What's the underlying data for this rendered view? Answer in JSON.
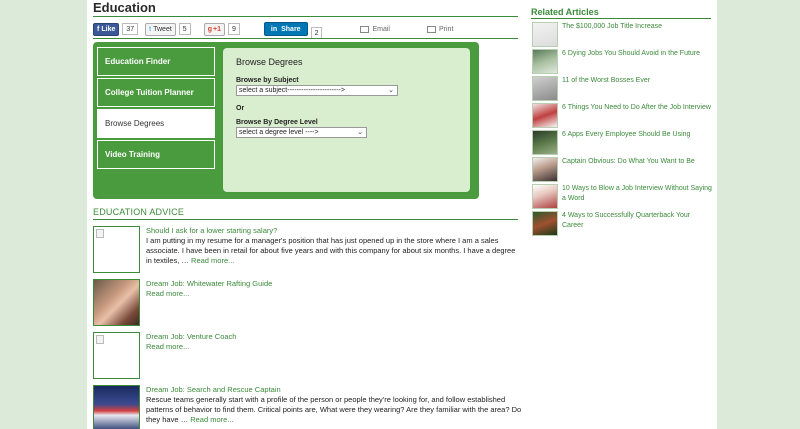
{
  "header": {
    "title": "Education"
  },
  "share": {
    "fb_label": "Like",
    "fb_count": "37",
    "tweet_label": "Tweet",
    "tweet_count": "5",
    "gplus_label": "+1",
    "gplus_count": "9",
    "linkedin_label": "Share",
    "linkedin_count": "2",
    "email_label": "Email",
    "print_label": "Print"
  },
  "tabs": [
    {
      "label": "Education Finder"
    },
    {
      "label": "College Tuition Planner"
    },
    {
      "label": "Browse Degrees"
    },
    {
      "label": "Video Training"
    }
  ],
  "panel": {
    "title": "Browse Degrees",
    "subject_label": "Browse by Subject",
    "subject_value": "select a subject----------------------->",
    "or_label": "Or",
    "degree_label": "Browse By Degree Level",
    "degree_value": "select a degree level ---->"
  },
  "advice": {
    "title": "EDUCATION ADVICE",
    "more_label": "Read more...",
    "items": [
      {
        "link": "Should I ask for a lower starting salary?",
        "text": "I am putting in my resume for a manager's position that has just opened up in the store where I am a sales associate. I have been in retail for about five years and with this company for about six months. I have a degree in textiles, …"
      },
      {
        "link": "Dream Job: Whitewater Rafting Guide",
        "text": ""
      },
      {
        "link": "Dream Job: Venture Coach",
        "text": ""
      },
      {
        "link": "Dream Job: Search and Rescue Captain",
        "text": "Rescue teams generally start with a profile of the person or people they're looking for, and follow established patterns of behavior to find them. Critical points are, What were they wearing? Are they familiar with the area? Do they have …"
      }
    ]
  },
  "related": {
    "title": "Related Articles",
    "items": [
      {
        "label": "The $100,000 Job Title Increase"
      },
      {
        "label": "6 Dying Jobs You Should Avoid in the Future"
      },
      {
        "label": "11 of the Worst Bosses Ever"
      },
      {
        "label": "6 Things You Need to Do After the Job Interview"
      },
      {
        "label": "6 Apps Every Employee Should Be Using"
      },
      {
        "label": "Captain Obvious: Do What You Want to Be"
      },
      {
        "label": "10 Ways to Blow a Job Interview Without Saying a Word"
      },
      {
        "label": "4 Ways to Successfully Quarterback Your Career"
      }
    ]
  }
}
